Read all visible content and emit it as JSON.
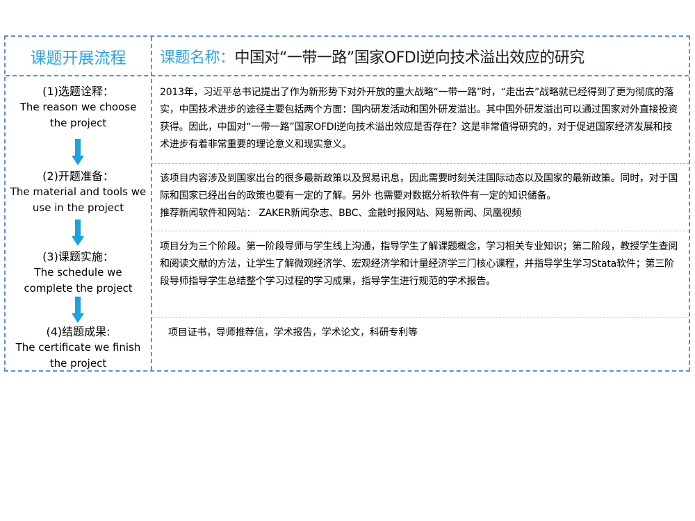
{
  "header": {
    "left_title": "课题开展流程",
    "right_label": "课题名称：",
    "right_title": "中国对“一带一路”国家OFDI逆向技术溢出效应的研究"
  },
  "steps": [
    {
      "zh": "(1)选题诠释：",
      "en_line1": "The reason we choose",
      "en_line2": "the project"
    },
    {
      "zh": "(2)开题准备：",
      "en_line1": "The material and tools we",
      "en_line2": "use in the project"
    },
    {
      "zh": "(3)课题实施：",
      "en_line1": "The schedule we",
      "en_line2": "complete the project"
    },
    {
      "zh": "(4)结题成果:",
      "en_line1": "The certificate we finish",
      "en_line2": "the project"
    }
  ],
  "contents": [
    {
      "text": "2013年，习近平总书记提出了作为新形势下对外开放的重大战略“一带一路”时，“走出去”战略就已经得到了更为彻底的落实，中国技术进步的途径主要包括两个方面：国内研发活动和国外研发溢出。其中国外研发溢出可以通过国家对外直接投资获得。因此，中国对“一带一路”国家OFDI逆向技术溢出效应是否存在？这是非常值得研究的，对于促进国家经济发展和技术进步有着非常重要的理论意义和现实意义。"
    },
    {
      "text": "该项目内容涉及到国家出台的很多最新政策以及贸易讯息，因此需要时刻关注国际动态以及国家的最新政策。同时，对于国际和国家已经出台的政策也要有一定的了解。另外 也需要对数据分析软件有一定的知识储备。",
      "extra": "推荐新闻软件和网站： ZAKER新闻杂志、BBC、金融时报网站、网易新闻、凤凰视频"
    },
    {
      "text": "项目分为三个阶段。第一阶段导师与学生线上沟通，指导学生了解课题概念，学习相关专业知识；第二阶段，教授学生查阅和阅读文献的方法，让学生了解微观经济学、宏观经济学和计量经济学三门核心课程，并指导学生学习Stata软件；第三阶段导师指导学生总结整个学习过程的学习成果，指导学生进行规范的学术报告。"
    },
    {
      "text": "项目证书，导师推荐信，学术报告，学术论文，科研专利等"
    }
  ],
  "colors": {
    "accent": "#2fa5dc",
    "border": "#5a8fd0",
    "arrow": "#1ba3dc"
  },
  "icons": {
    "step_arrow": "down-arrow-icon"
  }
}
